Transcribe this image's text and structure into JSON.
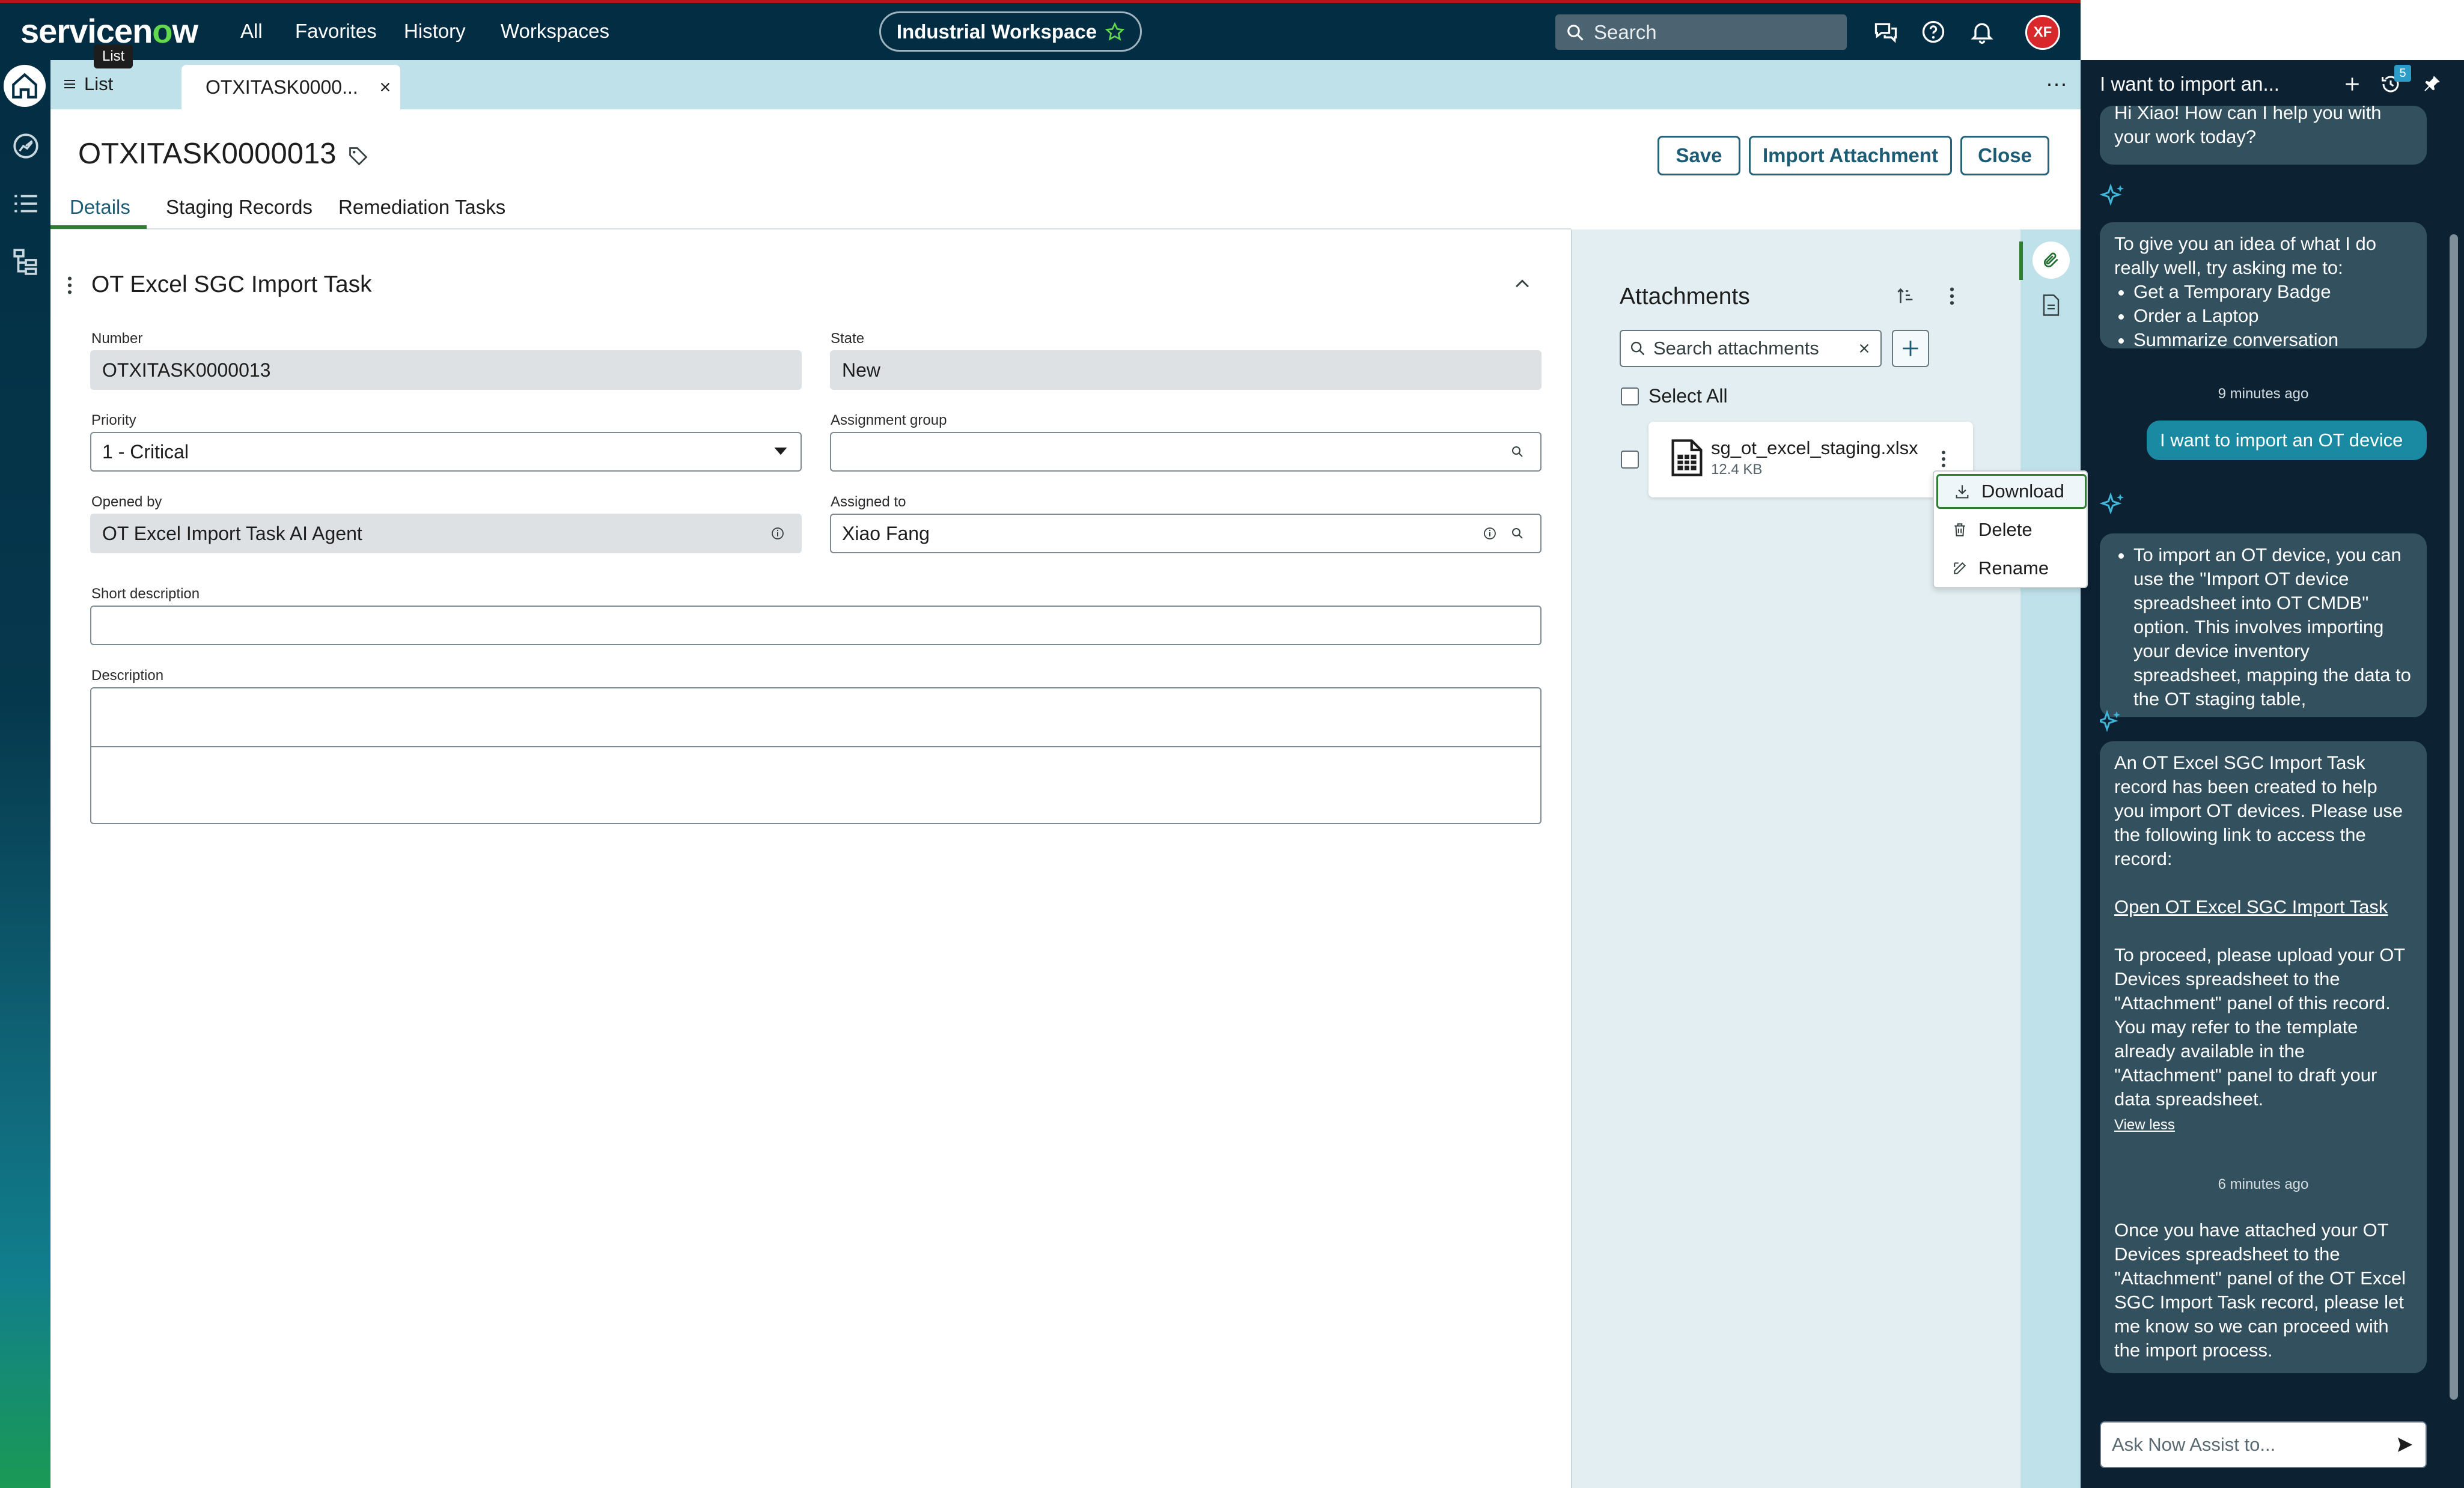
{
  "topnav": {
    "logo_text_a": "servicen",
    "logo_text_b": "w",
    "links": [
      "All",
      "Favorites",
      "History",
      "Workspaces"
    ],
    "workspace": "Industrial Workspace",
    "search_placeholder": "Search",
    "avatar_initials": "XF",
    "colors": {
      "bar": "#032d42",
      "accent": "#b3151a",
      "logo_green": "#62d84e"
    }
  },
  "tabs": {
    "list_label": "List",
    "tooltip": "List",
    "record_tab": "OTXITASK0000...",
    "more": "···"
  },
  "record": {
    "title": "OTXITASK0000013",
    "buttons": {
      "save": "Save",
      "import": "Import Attachment",
      "close": "Close"
    },
    "subtabs": [
      "Details",
      "Staging Records",
      "Remediation Tasks"
    ],
    "section_title": "OT Excel SGC Import Task",
    "fields": {
      "number_label": "Number",
      "number": "OTXITASK0000013",
      "state_label": "State",
      "state": "New",
      "priority_label": "Priority",
      "priority": "1 - Critical",
      "assignment_group_label": "Assignment group",
      "assignment_group": "",
      "opened_by_label": "Opened by",
      "opened_by": "OT Excel Import Task AI Agent",
      "assigned_to_label": "Assigned to",
      "assigned_to": "Xiao Fang",
      "short_description_label": "Short description",
      "short_description": "",
      "description_label": "Description",
      "description": ""
    }
  },
  "attachments": {
    "title": "Attachments",
    "search_placeholder": "Search attachments",
    "select_all": "Select All",
    "file": {
      "name": "sg_ot_excel_staging.xlsx",
      "size": "12.4 KB"
    },
    "menu": [
      "Download",
      "Delete",
      "Rename"
    ]
  },
  "chat": {
    "title": "I want to import an...",
    "badge_count": "5",
    "greeting": "Hi Xiao! How can I help you with your work today?",
    "suggest_intro": "To give you an idea of what I do really well, try asking me to:",
    "suggestions": [
      "Get a Temporary Badge",
      "Order a Laptop",
      "Summarize conversation"
    ],
    "ts1": "9 minutes ago",
    "user_msg": "I want to import an OT device",
    "reply1": "To import an OT device, you can use the \"Import OT device spreadsheet into OT CMDB\" option. This involves importing your device inventory spreadsheet, mapping the data to the OT staging table,",
    "reply2_p1": "An OT Excel SGC Import Task record has been created to help you import OT devices. Please use the following link to access the record:",
    "reply2_link": "Open OT Excel SGC Import Task",
    "reply2_p2": "To proceed, please upload your OT Devices spreadsheet to the \"Attachment\" panel of this record. You may refer to the template already available in the \"Attachment\" panel to draft your data spreadsheet.",
    "view_less": "View less",
    "ts2": "6 minutes ago",
    "reply3": "Once you have attached your OT Devices spreadsheet to the \"Attachment\" panel of the OT Excel SGC Import Task record, please let me know so we can proceed with the import process.",
    "input_placeholder": "Ask Now Assist to..."
  }
}
